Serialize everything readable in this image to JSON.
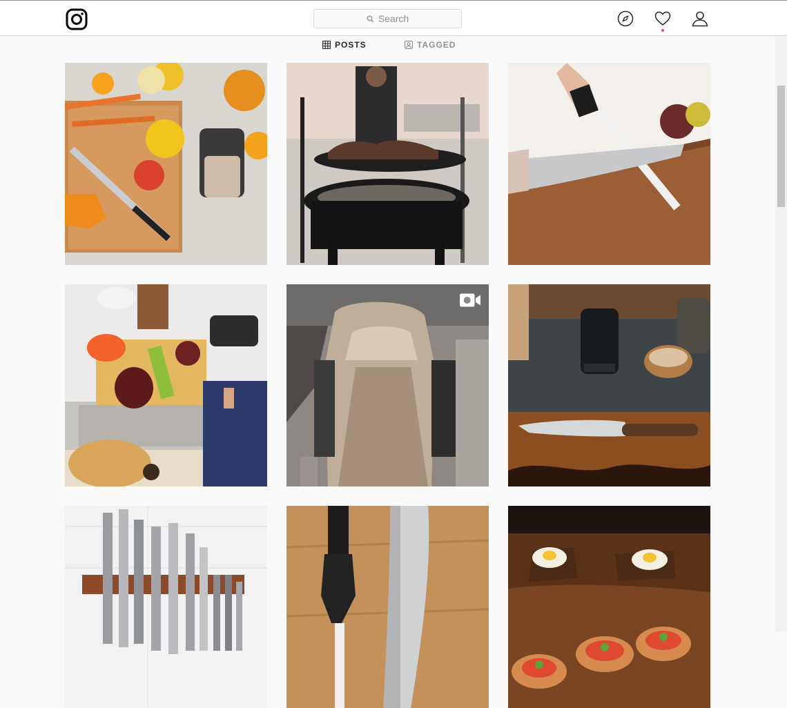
{
  "header": {
    "search_placeholder": "Search"
  },
  "icons": {
    "logo": "instagram-logo-icon",
    "explore": "compass-icon",
    "activity": "heart-icon",
    "profile": "person-icon"
  },
  "tabs": [
    {
      "label": "POSTS",
      "active": true
    },
    {
      "label": "TAGGED",
      "active": false
    }
  ],
  "posts": [
    {
      "alt": "Vegetables, chef knife and electric sharpener on cutting board",
      "type": "photo"
    },
    {
      "alt": "Grill with meat on outdoor stand",
      "type": "photo"
    },
    {
      "alt": "MISEN knife being honed on a white rod",
      "type": "photo"
    },
    {
      "alt": "Kitchen counter with produce, knife block, sharpener and dog",
      "type": "photo"
    },
    {
      "alt": "Close-up of knife sharpener slots",
      "type": "video"
    },
    {
      "alt": "Electric sharpener and chef knife on wood",
      "type": "photo"
    },
    {
      "alt": "Knives on a magnetic wall strip",
      "type": "photo"
    },
    {
      "alt": "Sharpening rod beside a santoku knife",
      "type": "photo"
    },
    {
      "alt": "Appetizers on a wooden board",
      "type": "photo"
    }
  ],
  "colors": {
    "badge_red": "#ed4956",
    "border": "#dbdbdb",
    "muted": "#8e8e8e"
  }
}
